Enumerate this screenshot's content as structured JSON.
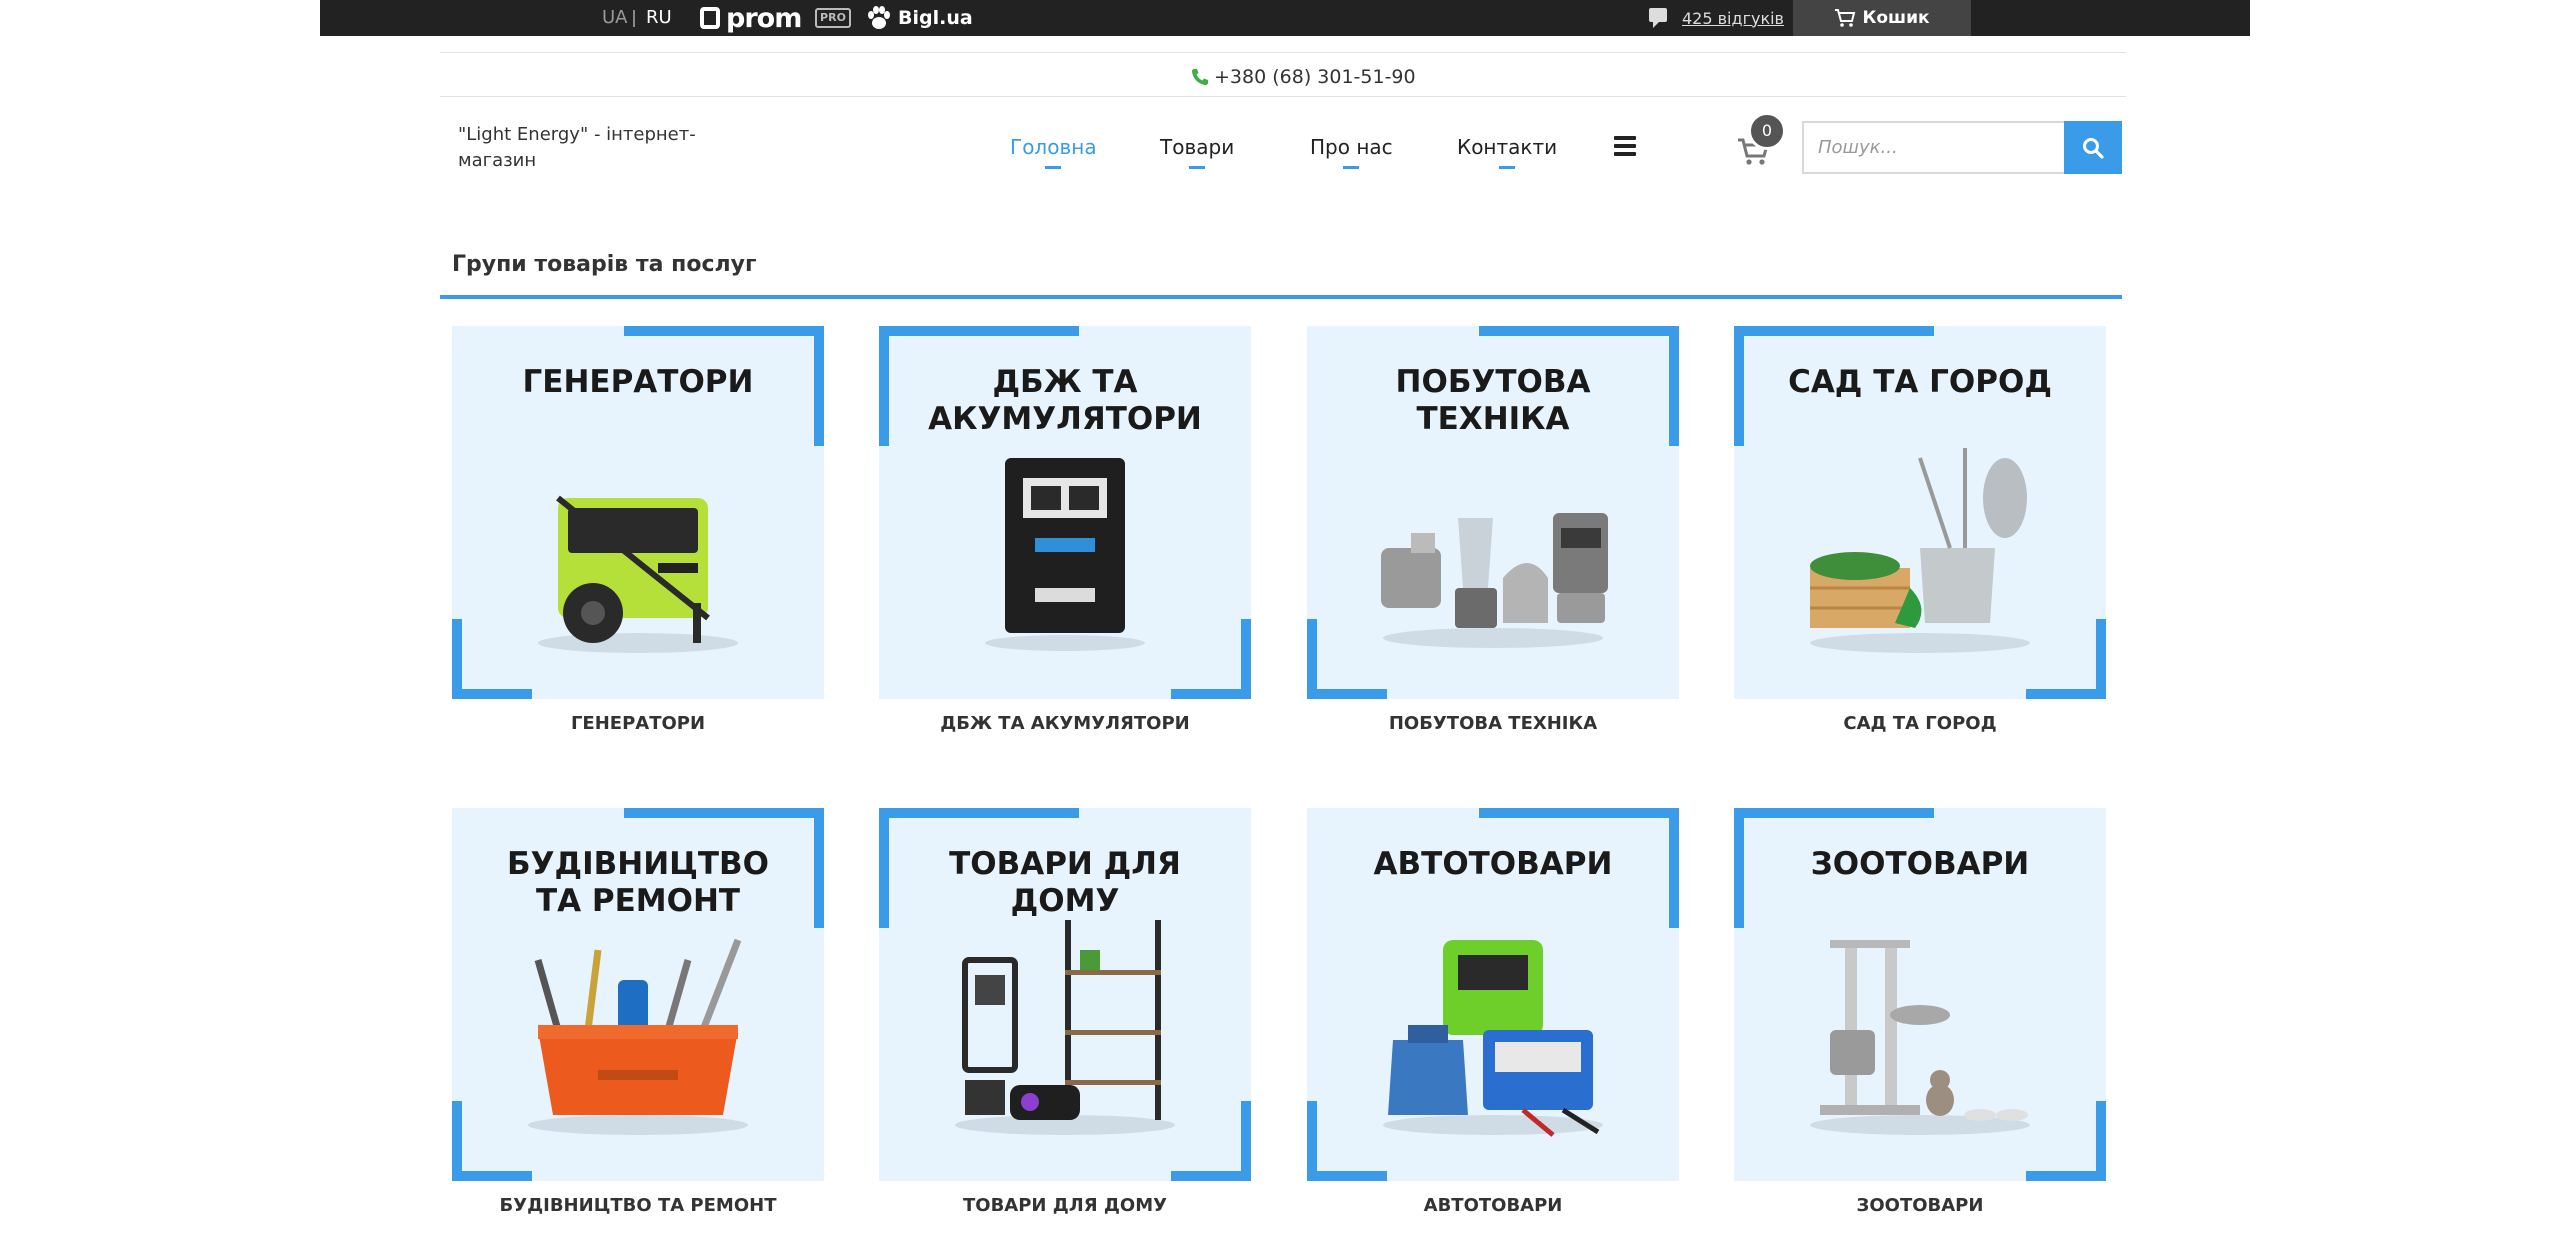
{
  "topbar": {
    "lang_ua": "UA",
    "lang_ru": "RU",
    "prom": "prom",
    "pro": "PRO",
    "bigl": "Bigl.ua",
    "reviews": "425 відгуків",
    "cart": "Кошик"
  },
  "contact": {
    "phone": "+380 (68) 301-51-90"
  },
  "header": {
    "brand": "\"Light Energy\" - інтернет-магазин",
    "nav": [
      "Головна",
      "Товари",
      "Про нас",
      "Контакти"
    ],
    "cart_count": "0",
    "search_placeholder": "Пошук..."
  },
  "section": {
    "title": "Групи товарів та послуг"
  },
  "categories": [
    {
      "tile_title": "ГЕНЕРАТОРИ",
      "caption": "ГЕНЕРАТОРИ",
      "icon": "generator-icon"
    },
    {
      "tile_title": "ДБЖ ТА\nАКУМУЛЯТОРИ",
      "caption": "ДБЖ ТА АКУМУЛЯТОРИ",
      "icon": "inverter-icon"
    },
    {
      "tile_title": "ПОБУТОВА\nТЕХНІКА",
      "caption": "ПОБУТОВА ТЕХНІКА",
      "icon": "appliances-icon"
    },
    {
      "tile_title": "САД ТА ГОРОД",
      "caption": "САД ТА ГОРОД",
      "icon": "garden-tools-icon"
    },
    {
      "tile_title": "БУДІВНИЦТВО\nТА РЕМОНТ",
      "caption": "БУДІВНИЦТВО ТА РЕМОНТ",
      "icon": "toolbox-icon"
    },
    {
      "tile_title": "ТОВАРИ ДЛЯ\nДОМУ",
      "caption": "ТОВАРИ ДЛЯ ДОМУ",
      "icon": "home-goods-icon"
    },
    {
      "tile_title": "АВТОТОВАРИ",
      "caption": "АВТОТОВАРИ",
      "icon": "car-charger-icon"
    },
    {
      "tile_title": "ЗООТОВАРИ",
      "caption": "ЗООТОВАРИ",
      "icon": "cat-tree-icon"
    }
  ],
  "colors": {
    "accent": "#3a9be8",
    "topbar": "#222222",
    "tile_bg": "#e8f4fd"
  }
}
